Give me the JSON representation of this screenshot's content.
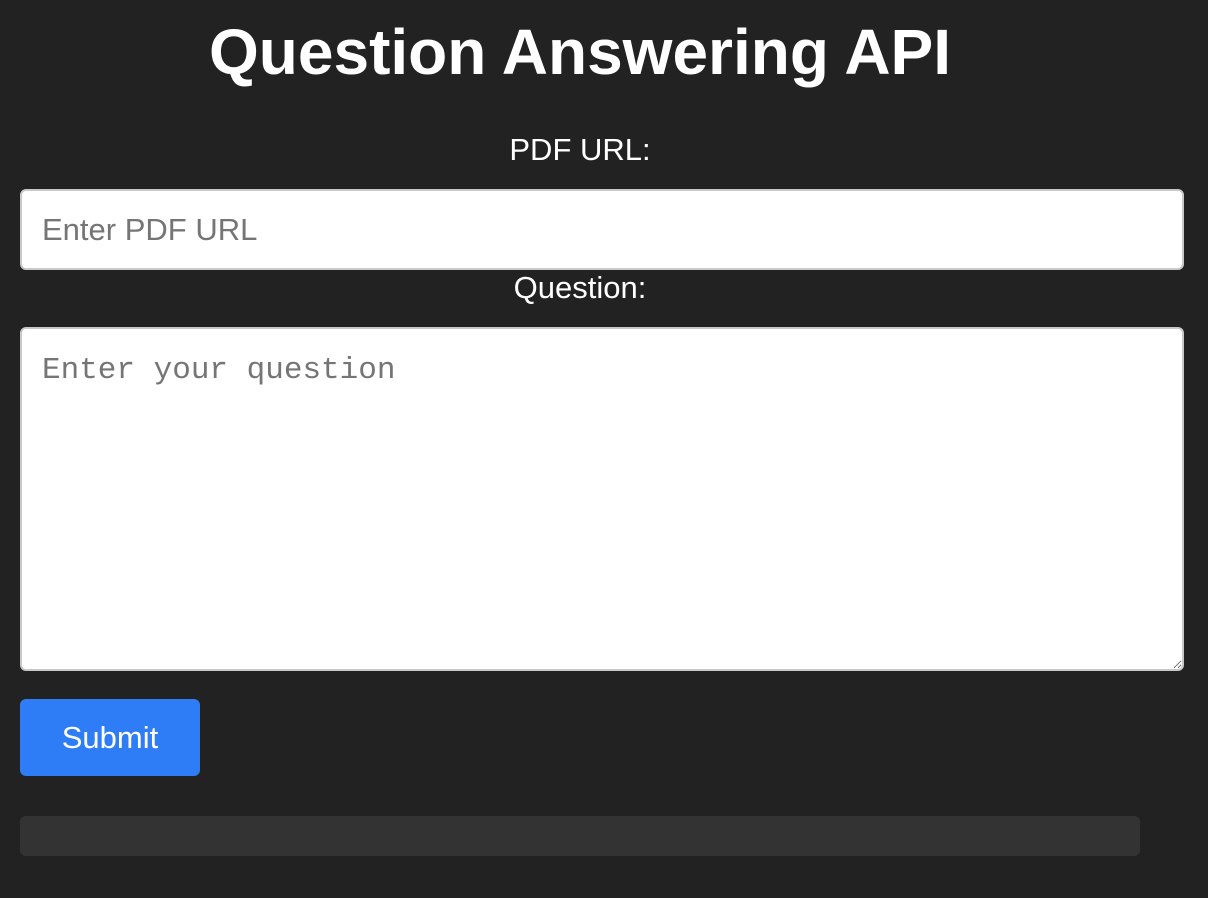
{
  "header": {
    "title": "Question Answering API"
  },
  "form": {
    "pdf_url": {
      "label": "PDF URL:",
      "value": "",
      "placeholder": "Enter PDF URL"
    },
    "question": {
      "label": "Question:",
      "value": "",
      "placeholder": "Enter your question"
    },
    "submit_label": "Submit"
  },
  "result": {
    "text": ""
  },
  "colors": {
    "background": "#222222",
    "accent": "#2f7df6",
    "result_box": "#333333"
  }
}
